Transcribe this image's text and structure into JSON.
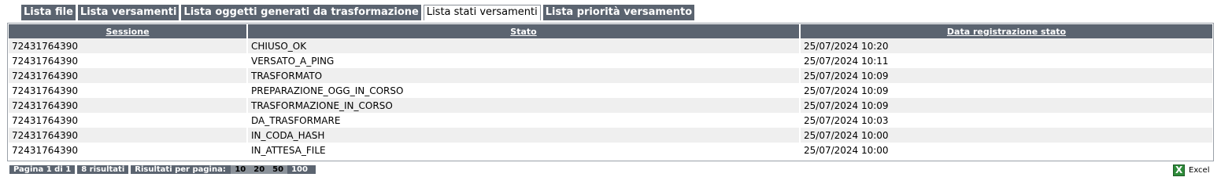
{
  "tabs": [
    {
      "label": "Lista file",
      "active": false
    },
    {
      "label": "Lista versamenti",
      "active": false
    },
    {
      "label": "Lista oggetti generati da trasformazione",
      "active": false
    },
    {
      "label": "Lista stati versamenti",
      "active": true
    },
    {
      "label": "Lista priorità versamento",
      "active": false
    }
  ],
  "table": {
    "headers": [
      "Sessione",
      "Stato",
      "Data registrazione stato"
    ],
    "rows": [
      [
        "72431764390",
        "CHIUSO_OK",
        "25/07/2024 10:20"
      ],
      [
        "72431764390",
        "VERSATO_A_PING",
        "25/07/2024 10:11"
      ],
      [
        "72431764390",
        "TRASFORMATO",
        "25/07/2024 10:09"
      ],
      [
        "72431764390",
        "PREPARAZIONE_OGG_IN_CORSO",
        "25/07/2024 10:09"
      ],
      [
        "72431764390",
        "TRASFORMAZIONE_IN_CORSO",
        "25/07/2024 10:09"
      ],
      [
        "72431764390",
        "DA_TRASFORMARE",
        "25/07/2024 10:03"
      ],
      [
        "72431764390",
        "IN_CODA_HASH",
        "25/07/2024 10:00"
      ],
      [
        "72431764390",
        "IN_ATTESA_FILE",
        "25/07/2024 10:00"
      ]
    ]
  },
  "pager": {
    "page_info": "Pagina 1 di 1",
    "results": "8 risultati",
    "per_page_label": "Risultati per pagina:",
    "sizes": [
      "10",
      "20",
      "50",
      "100"
    ],
    "selected_size": "100"
  },
  "export": {
    "label": "Excel",
    "icon": "excel-icon",
    "icon_color": "#2e8b3a"
  },
  "colors": {
    "header_bg": "#5b6470",
    "row_alt": "#efefef"
  }
}
